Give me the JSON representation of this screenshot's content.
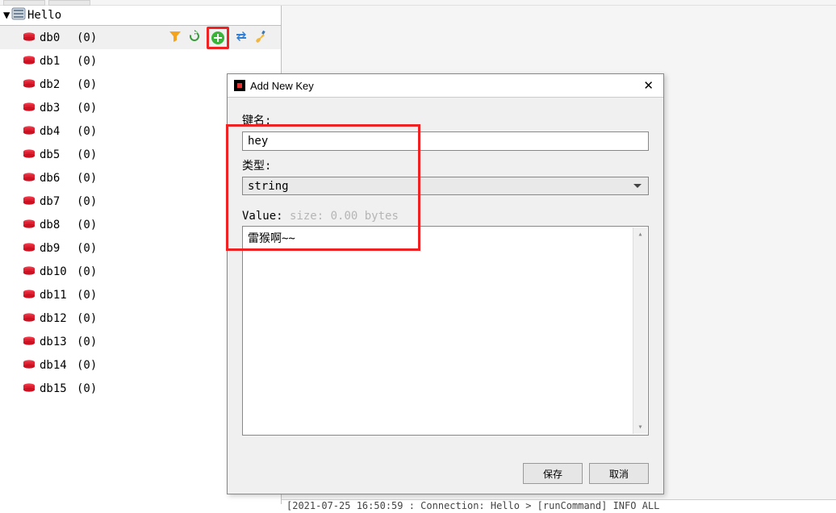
{
  "connection": {
    "name": "Hello"
  },
  "databases": [
    {
      "name": "db0",
      "count": "(0)",
      "selected": true
    },
    {
      "name": "db1",
      "count": "(0)"
    },
    {
      "name": "db2",
      "count": "(0)"
    },
    {
      "name": "db3",
      "count": "(0)"
    },
    {
      "name": "db4",
      "count": "(0)"
    },
    {
      "name": "db5",
      "count": "(0)"
    },
    {
      "name": "db6",
      "count": "(0)"
    },
    {
      "name": "db7",
      "count": "(0)"
    },
    {
      "name": "db8",
      "count": "(0)"
    },
    {
      "name": "db9",
      "count": "(0)"
    },
    {
      "name": "db10",
      "count": "(0)"
    },
    {
      "name": "db11",
      "count": "(0)"
    },
    {
      "name": "db12",
      "count": "(0)"
    },
    {
      "name": "db13",
      "count": "(0)"
    },
    {
      "name": "db14",
      "count": "(0)"
    },
    {
      "name": "db15",
      "count": "(0)"
    }
  ],
  "dialog": {
    "title": "Add New Key",
    "key_label": "键名:",
    "key_value": "hey",
    "type_label": "类型:",
    "type_value": "string",
    "value_label": "Value: ",
    "value_hint": "size: 0.00 bytes",
    "value_content": "雷猴啊~~",
    "save_label": "保存",
    "cancel_label": "取消"
  },
  "log_line": "[2021-07-25 16:50:59 : Connection: Hello > [runCommand] INFO ALL"
}
